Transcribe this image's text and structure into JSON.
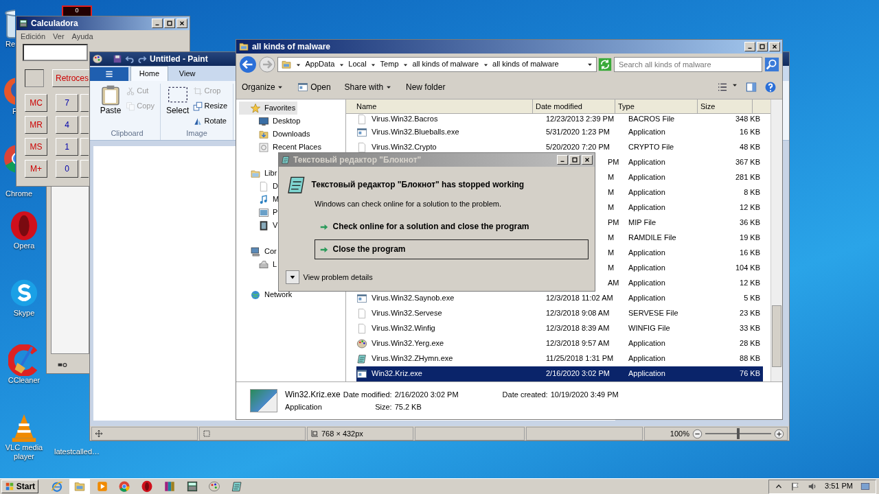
{
  "desktop": {
    "icons": [
      {
        "label": "Re"
      },
      {
        "label": "F"
      },
      {
        "label": "Chrome"
      },
      {
        "label": "Opera"
      },
      {
        "label": "Skype"
      },
      {
        "label": "CCleaner"
      },
      {
        "label": "VLC media player"
      }
    ],
    "second_column_icons": [
      {
        "label": "latestcalled…"
      }
    ],
    "corner_window": {
      "text": "0"
    }
  },
  "calculator": {
    "title": "Calculadora",
    "menu": [
      "Edición",
      "Ver",
      "Ayuda"
    ],
    "backspace": "Retroces",
    "memory_keys": [
      "MC",
      "MR",
      "MS",
      "M+"
    ],
    "digit_keys": [
      "7",
      "4",
      "1",
      "0"
    ]
  },
  "paint": {
    "title": "Untitled - Paint",
    "tabs": [
      {
        "label": "Home",
        "selected": true
      },
      {
        "label": "View",
        "selected": false
      }
    ],
    "paste": "Paste",
    "select": "Select",
    "clipboard_tools": [
      {
        "label": "Cut",
        "disabled": true
      },
      {
        "label": "Copy",
        "disabled": true
      }
    ],
    "image_tools": [
      {
        "label": "Crop",
        "disabled": true
      },
      {
        "label": "Resize",
        "disabled": false
      },
      {
        "label": "Rotate",
        "disabled": false
      }
    ],
    "groups": [
      "Clipboard",
      "Image"
    ],
    "status": {
      "size": "768 × 432px",
      "zoom": "100%"
    },
    "zoom_slider": {
      "level": 0.5
    }
  },
  "explorer": {
    "title": "all kinds of malware",
    "breadcrumb": [
      "AppData",
      "Local",
      "Temp",
      "all kinds of malware",
      "all kinds of malware"
    ],
    "search": {
      "placeholder": "Search all kinds of malware"
    },
    "toolbar": [
      {
        "label": "Organize",
        "kind": "menu"
      },
      {
        "label": "Open",
        "kind": "open"
      },
      {
        "label": "Share with",
        "kind": "menu"
      },
      {
        "label": "New folder",
        "kind": "plain"
      }
    ],
    "nav": [
      {
        "label": "Favorites",
        "selected": true,
        "children": [
          {
            "label": "Desktop",
            "selected": false
          },
          {
            "label": "Downloads",
            "selected": false
          },
          {
            "label": "Recent Places",
            "selected": false
          }
        ]
      },
      {
        "label": "Libr",
        "selected": false,
        "children": [
          {
            "label": "D",
            "selected": false
          },
          {
            "label": "M",
            "selected": false
          },
          {
            "label": "P",
            "selected": false
          },
          {
            "label": "V",
            "selected": false
          }
        ]
      },
      {
        "label": "Cor",
        "selected": false,
        "children": [
          {
            "label": "L",
            "selected": false
          }
        ]
      },
      {
        "label": "Network",
        "selected": false
      }
    ],
    "columns": [
      "Name",
      "Date modified",
      "Type",
      "Size"
    ],
    "rows": [
      {
        "kind": "document",
        "name": "Virus.Win32.Bacros",
        "date": "12/23/2013 2:39 PM",
        "type": "BACROS File",
        "size": "348 KB",
        "selected": false
      },
      {
        "kind": "application",
        "name": "Virus.Win32.Blueballs.exe",
        "date": "5/31/2020 1:23 PM",
        "type": "Application",
        "size": "16 KB",
        "selected": false
      },
      {
        "kind": "document",
        "name": "Virus.Win32.Crypto",
        "date": "5/20/2020 7:20 PM",
        "type": "CRYPTO File",
        "size": "48 KB",
        "selected": false
      },
      {
        "kind": "covered",
        "date": "PM",
        "type": "Application",
        "size": "367 KB",
        "selected": false
      },
      {
        "kind": "covered",
        "date": "M",
        "type": "Application",
        "size": "281 KB",
        "selected": false
      },
      {
        "kind": "covered",
        "date": "M",
        "type": "Application",
        "size": "8 KB",
        "selected": false
      },
      {
        "kind": "covered",
        "date": "M",
        "type": "Application",
        "size": "12 KB",
        "selected": false
      },
      {
        "kind": "covered",
        "date": "PM",
        "type": "MIP File",
        "size": "36 KB",
        "selected": false
      },
      {
        "kind": "covered",
        "date": "M",
        "type": "RAMDILE File",
        "size": "19 KB",
        "selected": false
      },
      {
        "kind": "covered",
        "date": "M",
        "type": "Application",
        "size": "16 KB",
        "selected": false
      },
      {
        "kind": "covered",
        "date": "M",
        "type": "Application",
        "size": "104 KB",
        "selected": false
      },
      {
        "kind": "covered",
        "date": "AM",
        "type": "Application",
        "size": "12 KB",
        "selected": false
      },
      {
        "kind": "application",
        "name": "Virus.Win32.Saynob.exe",
        "date": "12/3/2018 11:02 AM",
        "type": "Application",
        "size": "5 KB",
        "selected": false
      },
      {
        "kind": "document",
        "name": "Virus.Win32.Servese",
        "date": "12/3/2018 9:08 AM",
        "type": "SERVESE File",
        "size": "23 KB",
        "selected": false
      },
      {
        "kind": "document",
        "name": "Virus.Win32.Winfig",
        "date": "12/3/2018 8:39 AM",
        "type": "WINFIG File",
        "size": "33 KB",
        "selected": false
      },
      {
        "kind": "palette",
        "name": "Virus.Win32.Yerg.exe",
        "date": "12/3/2018 9:57 AM",
        "type": "Application",
        "size": "28 KB",
        "selected": false
      },
      {
        "kind": "notepad",
        "name": "Virus.Win32.ZHymn.exe",
        "date": "11/25/2018 1:31 PM",
        "type": "Application",
        "size": "88 KB",
        "selected": false
      },
      {
        "kind": "application",
        "name": "Win32.Kriz.exe",
        "date": "2/16/2020 3:02 PM",
        "type": "Application",
        "size": "76 KB",
        "selected": true
      }
    ],
    "details": {
      "name": "Win32.Kriz.exe",
      "type": "Application",
      "fields": [
        {
          "label": "Date modified:",
          "value": "2/16/2020 3:02 PM"
        },
        {
          "label": "Size:",
          "value": "75.2 KB"
        },
        {
          "label": "Date created:",
          "value": "10/19/2020 3:49 PM"
        }
      ]
    }
  },
  "dialog": {
    "title": "Текстовый редактор \"Блокнот\"",
    "heading": "Текстовый редактор \"Блокнот\" has stopped working",
    "message": "Windows can check online for a solution to the problem.",
    "options": [
      {
        "label": "Check online for a solution and close the program",
        "selected": false
      },
      {
        "label": "Close the program",
        "selected": true
      }
    ],
    "details_toggle": "View problem details"
  },
  "taskbar": {
    "start": "Start",
    "apps": [
      {
        "selected": false
      },
      {
        "selected": true
      },
      {
        "selected": false
      },
      {
        "selected": false
      },
      {
        "selected": false
      },
      {
        "selected": false
      },
      {
        "selected": false
      },
      {
        "selected": false
      },
      {
        "selected": false
      }
    ],
    "clock": "3:51 PM"
  }
}
